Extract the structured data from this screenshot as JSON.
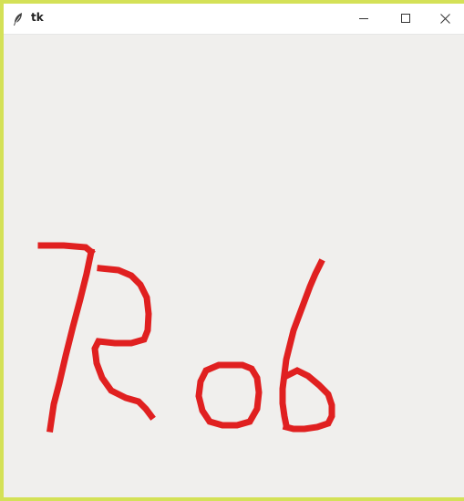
{
  "window": {
    "title": "tk",
    "controls": {
      "minimize_icon": "minimize-icon",
      "maximize_icon": "maximize-icon",
      "close_icon": "close-icon"
    }
  },
  "canvas": {
    "background": "#f0efed",
    "stroke_color": "#e02020"
  },
  "colors": {
    "desktop": "#d4e157",
    "titlebar": "#ffffff"
  }
}
